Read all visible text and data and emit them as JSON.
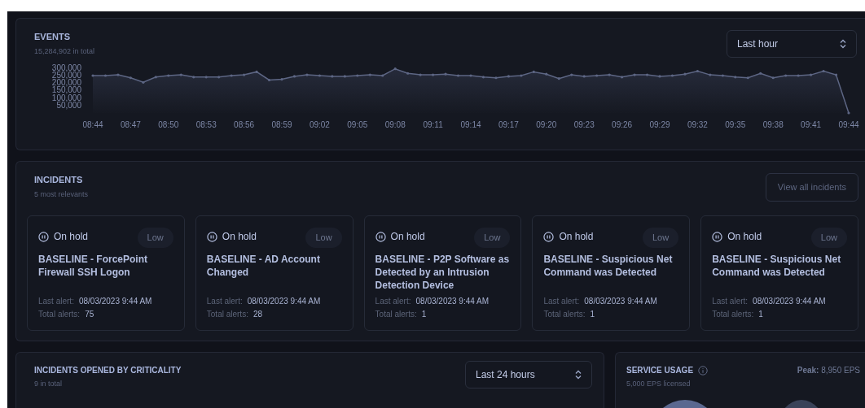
{
  "events": {
    "title": "EVENTS",
    "subtitle": "15,284,902 in total",
    "range_select": {
      "value": "Last hour"
    },
    "chart_data": {
      "type": "line",
      "categories": [
        "08:44",
        null,
        null,
        "08:47",
        null,
        null,
        "08:50",
        null,
        null,
        "08:53",
        null,
        null,
        "08:56",
        null,
        null,
        "08:59",
        null,
        null,
        "09:02",
        null,
        null,
        "09:05",
        null,
        null,
        "09:08",
        null,
        null,
        "09:11",
        null,
        null,
        "09:14",
        null,
        null,
        "09:17",
        null,
        null,
        "09:20",
        null,
        null,
        "09:23",
        null,
        null,
        "09:26",
        null,
        null,
        "09:29",
        null,
        null,
        "09:32",
        null,
        null,
        "09:35",
        null,
        null,
        "09:38",
        null,
        null,
        "09:41",
        null,
        null,
        "09:44"
      ],
      "series": [
        {
          "color": "#5d6684",
          "values": [
            250000,
            250000,
            255000,
            235000,
            205000,
            240000,
            250000,
            255000,
            240000,
            240000,
            240000,
            250000,
            255000,
            275000,
            220000,
            225000,
            245000,
            255000,
            250000,
            245000,
            245000,
            250000,
            255000,
            250000,
            295000,
            265000,
            255000,
            255000,
            260000,
            250000,
            250000,
            240000,
            235000,
            245000,
            250000,
            275000,
            260000,
            230000,
            255000,
            245000,
            250000,
            255000,
            240000,
            255000,
            255000,
            245000,
            250000,
            260000,
            280000,
            255000,
            250000,
            240000,
            235000,
            265000,
            235000,
            250000,
            250000,
            255000,
            280000,
            255000,
            0
          ]
        }
      ],
      "ylim": [
        0,
        300000
      ],
      "yticks": [
        {
          "value": 50000,
          "label": "50,000"
        },
        {
          "value": 100000,
          "label": "100,000"
        },
        {
          "value": 150000,
          "label": "150,000"
        },
        {
          "value": 200000,
          "label": "200,000"
        },
        {
          "value": 250000,
          "label": "250,000"
        },
        {
          "value": 300000,
          "label": "300,000"
        }
      ]
    }
  },
  "incidents": {
    "title": "INCIDENTS",
    "subtitle": "5 most relevants",
    "button": "View all incidents",
    "cards": [
      {
        "status": "On hold",
        "severity": "Low",
        "name": "BASELINE - ForcePoint Firewall SSH Logon",
        "last_alert_label": "Last alert:",
        "last_alert": "08/03/2023 9:44 AM",
        "total_label": "Total alerts:",
        "total": "75"
      },
      {
        "status": "On hold",
        "severity": "Low",
        "name": "BASELINE - AD Account Changed",
        "last_alert_label": "Last alert:",
        "last_alert": "08/03/2023 9:44 AM",
        "total_label": "Total alerts:",
        "total": "28"
      },
      {
        "status": "On hold",
        "severity": "Low",
        "name": "BASELINE - P2P Software as Detected by an Intrusion Detection Device",
        "last_alert_label": "Last alert:",
        "last_alert": "08/03/2023 9:44 AM",
        "total_label": "Total alerts:",
        "total": "1"
      },
      {
        "status": "On hold",
        "severity": "Low",
        "name": "BASELINE - Suspicious Net Command was Detected",
        "last_alert_label": "Last alert:",
        "last_alert": "08/03/2023 9:44 AM",
        "total_label": "Total alerts:",
        "total": "1"
      },
      {
        "status": "On hold",
        "severity": "Low",
        "name": "BASELINE - Suspicious Net Command was Detected",
        "last_alert_label": "Last alert:",
        "last_alert": "08/03/2023 9:44 AM",
        "total_label": "Total alerts:",
        "total": "1"
      }
    ]
  },
  "criticality": {
    "title": "INCIDENTS OPENED BY CRITICALITY",
    "subtitle": "9 in total",
    "range_select": {
      "value": "Last 24 hours"
    }
  },
  "service_usage": {
    "title": "SERVICE USAGE",
    "subtitle": "5,000 EPS licensed",
    "peak": "**Peak:** 8,950 EPS"
  }
}
